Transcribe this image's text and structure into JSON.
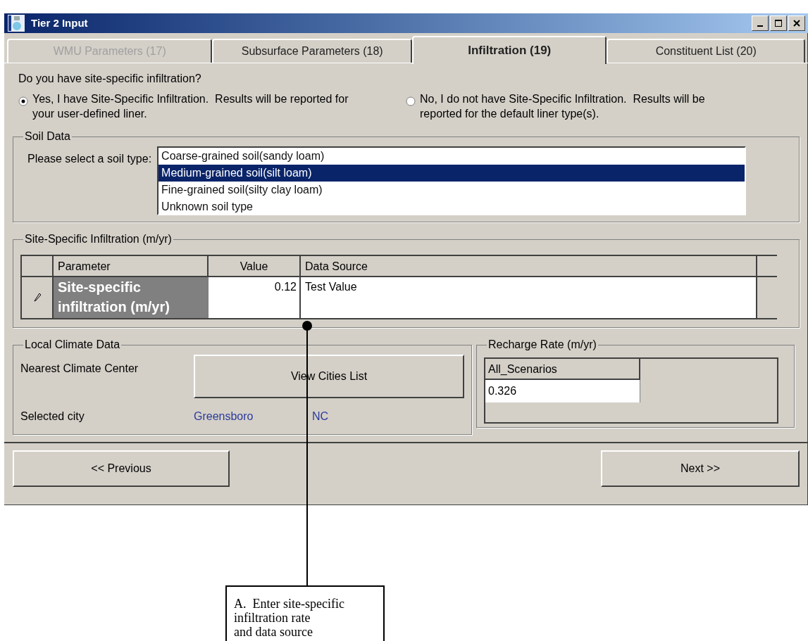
{
  "window": {
    "title": "Tier 2 Input"
  },
  "tabs": [
    {
      "label": "WMU Parameters (17)",
      "selected": false,
      "disabled": true
    },
    {
      "label": "Subsurface Parameters (18)",
      "selected": false,
      "disabled": false
    },
    {
      "label": "Infiltration (19)",
      "selected": true,
      "disabled": false
    },
    {
      "label": "Constituent List (20)",
      "selected": false,
      "disabled": false
    }
  ],
  "question": "Do you have site-specific infiltration?",
  "options": [
    {
      "label": "Yes, I have Site-Specific Infiltration.  Results will be reported for your user-defined liner.",
      "selected": true
    },
    {
      "label": "No, I do not have Site-Specific Infiltration.  Results will be reported for the default liner type(s).",
      "selected": false
    }
  ],
  "soil_data": {
    "title": "Soil Data",
    "prompt": "Please select a soil type:",
    "items": [
      {
        "label": "Coarse-grained soil(sandy loam)",
        "selected": false
      },
      {
        "label": "Medium-grained soil(silt loam)",
        "selected": true
      },
      {
        "label": "Fine-grained soil(silty clay loam)",
        "selected": false
      },
      {
        "label": "Unknown soil type",
        "selected": false
      }
    ]
  },
  "infiltration": {
    "title": "Site-Specific Infiltration (m/yr)",
    "columns": [
      "Parameter",
      "Value",
      "Data Source"
    ],
    "rows": [
      {
        "parameter": "Site-specific infiltration (m/yr)",
        "value": "0.12",
        "data_source": "Test Value"
      }
    ]
  },
  "climate": {
    "title": "Local Climate Data",
    "nearest_label": "Nearest Climate Center",
    "button": "View Cities List",
    "city_label": "Selected city",
    "city": "Greensboro",
    "state": "NC"
  },
  "recharge": {
    "title": "Recharge Rate (m/yr)",
    "column": "All_Scenarios",
    "value": "0.326"
  },
  "buttons": {
    "previous": "<< Previous",
    "next": "Next >>"
  },
  "callout": {
    "lines": [
      "A.  Enter site-specific",
      "infiltration rate",
      "and data source"
    ]
  }
}
